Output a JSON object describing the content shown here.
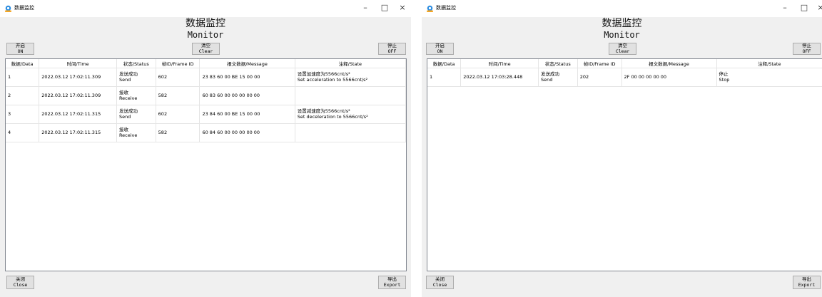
{
  "windows": [
    {
      "app_title": "数据监控",
      "header_title": "数据监控",
      "header_subtitle": "Monitor",
      "controls": {
        "minimize": "–",
        "maximize": "□",
        "close": "×"
      },
      "buttons": {
        "start": {
          "cn": "开启",
          "en": "ON"
        },
        "clear": {
          "cn": "清空",
          "en": "Clear"
        },
        "stop": {
          "cn": "停止",
          "en": "OFF"
        },
        "close": {
          "cn": "关闭",
          "en": "Close"
        },
        "export": {
          "cn": "导出",
          "en": "Export"
        }
      },
      "columns": [
        "数据/Data",
        "时间/Time",
        "状态/Status",
        "帧ID/Frame ID",
        "报文数据/Message",
        "注释/State"
      ],
      "rows": [
        {
          "data": "1",
          "time": "2022.03.12 17:02:11.309",
          "status_cn": "发送成功",
          "status_en": "Send",
          "frame_id": "602",
          "message": "23 83 60 00 BE 15 00 00",
          "note_cn": "设置加速度为5566cnt/s²",
          "note_en": "Set acceleration to 5566cnt/s²"
        },
        {
          "data": "2",
          "time": "2022.03.12 17:02:11.309",
          "status_cn": "接收",
          "status_en": "Receive",
          "frame_id": "582",
          "message": "60 83 60 00 00 00 00 00",
          "note_cn": "",
          "note_en": ""
        },
        {
          "data": "3",
          "time": "2022.03.12 17:02:11.315",
          "status_cn": "发送成功",
          "status_en": "Send",
          "frame_id": "602",
          "message": "23 84 60 00 BE 15 00 00",
          "note_cn": "设置减速度为5566cnt/s²",
          "note_en": "Set deceleration to 5566cnt/s²"
        },
        {
          "data": "4",
          "time": "2022.03.12 17:02:11.315",
          "status_cn": "接收",
          "status_en": "Receive",
          "frame_id": "582",
          "message": "60 84 60 00 00 00 00 00",
          "note_cn": "",
          "note_en": ""
        }
      ]
    },
    {
      "app_title": "数据监控",
      "header_title": "数据监控",
      "header_subtitle": "Monitor",
      "controls": {
        "minimize": "–",
        "maximize": "□",
        "close": "×"
      },
      "buttons": {
        "start": {
          "cn": "开启",
          "en": "ON"
        },
        "clear": {
          "cn": "清空",
          "en": "Clear"
        },
        "stop": {
          "cn": "停止",
          "en": "OFF"
        },
        "close": {
          "cn": "关闭",
          "en": "Close"
        },
        "export": {
          "cn": "导出",
          "en": "Export"
        }
      },
      "columns": [
        "数据/Data",
        "时间/Time",
        "状态/Status",
        "帧ID/Frame ID",
        "报文数据/Message",
        "注释/State"
      ],
      "rows": [
        {
          "data": "1",
          "time": "2022.03.12 17:03:28.448",
          "status_cn": "发送成功",
          "status_en": "Send",
          "frame_id": "202",
          "message": "2F 00 00 00 00 00",
          "note_cn": "停止",
          "note_en": "Stop"
        }
      ]
    }
  ],
  "colors": {
    "accent": "#2f8ee0",
    "window_bg": "#f0f0f0",
    "button_bg": "#e1e1e1",
    "grid_line": "#e5e5e5"
  },
  "icons": {
    "app": "app-logo-icon",
    "minimize": "minimize-icon",
    "maximize": "maximize-icon",
    "close": "close-icon"
  }
}
